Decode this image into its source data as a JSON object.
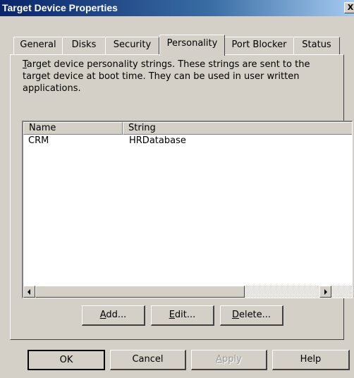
{
  "window": {
    "title": "Target Device Properties",
    "close_label": "X"
  },
  "tabs": [
    {
      "label": "General"
    },
    {
      "label": "Disks"
    },
    {
      "label": "Security"
    },
    {
      "label": "Personality",
      "active": true
    },
    {
      "label": "Port Blocker"
    },
    {
      "label": "Status"
    }
  ],
  "personality": {
    "description_mnemonic": "T",
    "description_rest": "arget device personality strings.  These strings are sent to the target device at boot time. They can be used in user written applications.",
    "columns": [
      "Name",
      "String"
    ],
    "rows": [
      {
        "name": "CRM",
        "string": "HRDatabase"
      }
    ],
    "add": {
      "mnemonic": "A",
      "rest": "dd..."
    },
    "edit": {
      "mnemonic": "E",
      "rest": "dit..."
    },
    "delete": {
      "mnemonic": "D",
      "rest": "elete..."
    }
  },
  "footer": {
    "ok": "OK",
    "cancel": "Cancel",
    "apply_mnemonic": "A",
    "apply_rest": "pply",
    "help": "Help"
  }
}
